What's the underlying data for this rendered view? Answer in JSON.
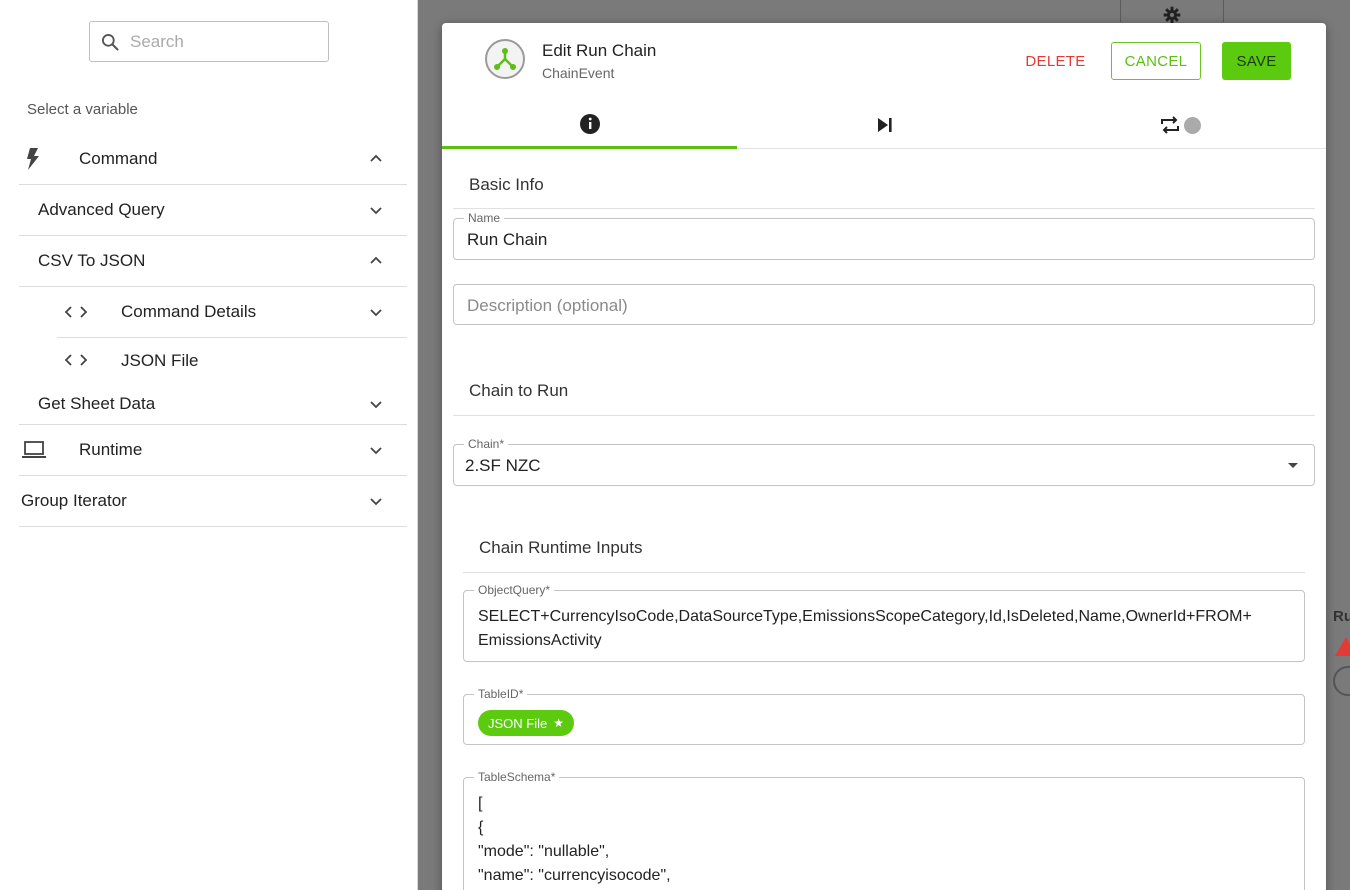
{
  "sidebar": {
    "search_placeholder": "Search",
    "select_label": "Select a variable",
    "items": [
      {
        "label": "Command"
      },
      {
        "label": "Advanced Query"
      },
      {
        "label": "CSV To JSON"
      },
      {
        "label": "Command Details"
      },
      {
        "label": "JSON File"
      },
      {
        "label": "Get Sheet Data"
      },
      {
        "label": "Runtime"
      },
      {
        "label": "Group Iterator"
      }
    ]
  },
  "modal": {
    "title": "Edit Run Chain",
    "subtitle": "ChainEvent",
    "delete_label": "DELETE",
    "cancel_label": "CANCEL",
    "save_label": "SAVE",
    "basic_info": {
      "heading": "Basic Info",
      "name_legend": "Name",
      "name_value": "Run Chain",
      "description_placeholder": "Description (optional)"
    },
    "chain_to_run": {
      "heading": "Chain to Run",
      "chain_legend": "Chain*",
      "chain_value": "2.SF NZC"
    },
    "runtime_inputs": {
      "heading": "Chain Runtime Inputs",
      "object_query_legend": "ObjectQuery*",
      "object_query_line1": "SELECT+CurrencyIsoCode,DataSourceType,EmissionsScopeCategory,Id,IsDeleted,Name,OwnerId+FROM+",
      "object_query_line2": "EmissionsActivity",
      "table_id_legend": "TableID*",
      "table_id_chip": "JSON File",
      "table_schema_legend": "TableSchema*",
      "schema_lines": [
        "[",
        "{",
        "\"mode\": \"nullable\",",
        "\"name\": \"currencyisocode\","
      ]
    }
  },
  "background": {
    "partial_text": "Ru"
  },
  "colors": {
    "accent": "#5cbf14",
    "delete": "#e53935",
    "save_bg": "#5ccb10"
  }
}
